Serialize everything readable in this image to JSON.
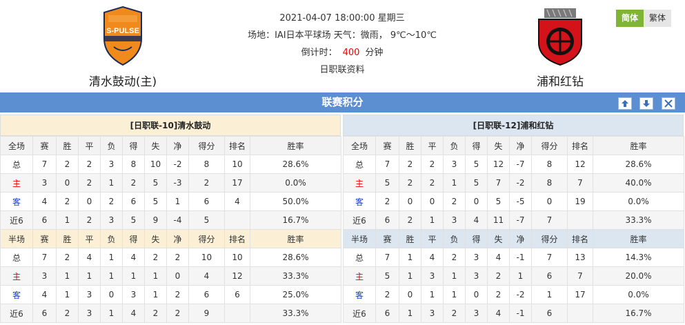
{
  "header": {
    "home_name": "清水鼓动(主)",
    "away_name": "浦和红钻",
    "home_logo_text": "S-PULSE",
    "datetime": "2021-04-07 18:00:00 星期三",
    "venue_line": "场地：IAI日本平球场 天气：微雨， 9℃～10℃",
    "countdown_label": "倒计时：",
    "countdown_value": "400",
    "countdown_unit": "分钟",
    "league_link": "日职联资料"
  },
  "lang": {
    "simplified": "简体",
    "traditional": "繁体"
  },
  "title_bar": {
    "title": "联赛积分"
  },
  "colors": {
    "title_bar": "#5b8fd2",
    "home_panel": "#fbf0d6",
    "away_panel": "#dce6f0",
    "lang_active": "#7fb533",
    "home_red": "#e00",
    "away_blue": "#1a3ec9"
  },
  "columns": [
    "赛",
    "胜",
    "平",
    "负",
    "得",
    "失",
    "净",
    "得分",
    "排名",
    "胜率"
  ],
  "home_table": {
    "title": "[日职联-10]清水鼓动",
    "full_label": "全场",
    "half_label": "半场",
    "full_rows": [
      [
        "总",
        "7",
        "2",
        "2",
        "3",
        "8",
        "10",
        "-2",
        "8",
        "10",
        "28.6%"
      ],
      [
        "主",
        "3",
        "0",
        "2",
        "1",
        "2",
        "5",
        "-3",
        "2",
        "17",
        "0.0%"
      ],
      [
        "客",
        "4",
        "2",
        "0",
        "2",
        "6",
        "5",
        "1",
        "6",
        "4",
        "50.0%"
      ],
      [
        "近6",
        "6",
        "1",
        "2",
        "3",
        "5",
        "9",
        "-4",
        "5",
        "",
        "16.7%"
      ]
    ],
    "half_rows": [
      [
        "总",
        "7",
        "2",
        "4",
        "1",
        "4",
        "2",
        "2",
        "10",
        "10",
        "28.6%"
      ],
      [
        "主",
        "3",
        "1",
        "1",
        "1",
        "1",
        "1",
        "0",
        "4",
        "12",
        "33.3%"
      ],
      [
        "客",
        "4",
        "1",
        "3",
        "0",
        "3",
        "1",
        "2",
        "6",
        "6",
        "25.0%"
      ],
      [
        "近6",
        "6",
        "2",
        "3",
        "1",
        "4",
        "2",
        "2",
        "9",
        "",
        "33.3%"
      ]
    ]
  },
  "away_table": {
    "title": "[日职联-12]浦和红钻",
    "full_label": "全场",
    "half_label": "半场",
    "full_rows": [
      [
        "总",
        "7",
        "2",
        "2",
        "3",
        "5",
        "12",
        "-7",
        "8",
        "12",
        "28.6%"
      ],
      [
        "主",
        "5",
        "2",
        "2",
        "1",
        "5",
        "7",
        "-2",
        "8",
        "7",
        "40.0%"
      ],
      [
        "客",
        "2",
        "0",
        "0",
        "2",
        "0",
        "5",
        "-5",
        "0",
        "19",
        "0.0%"
      ],
      [
        "近6",
        "6",
        "2",
        "1",
        "3",
        "4",
        "11",
        "-7",
        "7",
        "",
        "33.3%"
      ]
    ],
    "half_rows": [
      [
        "总",
        "7",
        "1",
        "4",
        "2",
        "3",
        "4",
        "-1",
        "7",
        "13",
        "14.3%"
      ],
      [
        "主",
        "5",
        "1",
        "3",
        "1",
        "3",
        "2",
        "1",
        "6",
        "7",
        "20.0%"
      ],
      [
        "客",
        "2",
        "0",
        "1",
        "1",
        "0",
        "2",
        "-2",
        "1",
        "17",
        "0.0%"
      ],
      [
        "近6",
        "6",
        "1",
        "3",
        "2",
        "3",
        "4",
        "-1",
        "6",
        "",
        "16.7%"
      ]
    ]
  }
}
